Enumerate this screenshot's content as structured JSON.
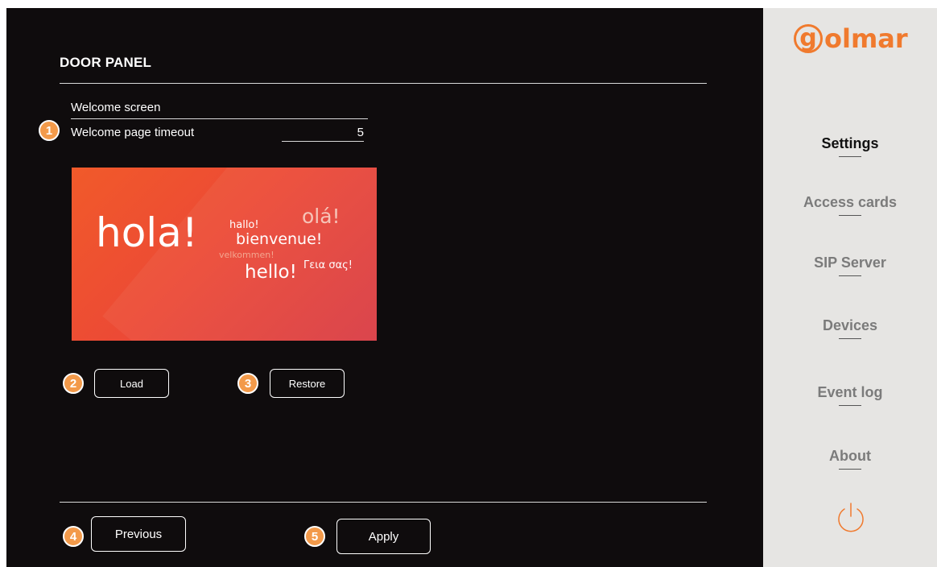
{
  "main": {
    "title": "DOOR PANEL",
    "section_label": "Welcome screen",
    "timeout": {
      "label": "Welcome page timeout",
      "value": "5"
    },
    "preview_words": {
      "hola": "hola!",
      "hallo": "hallo!",
      "ola": "olá!",
      "bienvenue": "bienvenue!",
      "velkommen": "velkommen!",
      "hello": "hello!",
      "greek": "Γεια σας!"
    },
    "buttons": {
      "load": "Load",
      "restore": "Restore",
      "previous": "Previous",
      "apply": "Apply"
    },
    "badges": [
      "1",
      "2",
      "3",
      "4",
      "5"
    ]
  },
  "sidebar": {
    "logo": {
      "g": "g",
      "rest": "olmar"
    },
    "items": [
      {
        "label": "Settings",
        "active": true
      },
      {
        "label": "Access cards",
        "active": false
      },
      {
        "label": "SIP Server",
        "active": false
      },
      {
        "label": "Devices",
        "active": false
      },
      {
        "label": "Event log",
        "active": false
      },
      {
        "label": "About",
        "active": false
      }
    ],
    "power_icon": "power-icon"
  },
  "colors": {
    "main_bg": "#0f0c0d",
    "sidebar_bg": "#e6e5e3",
    "accent": "#f39a4a",
    "logo": "#f07a2e"
  }
}
